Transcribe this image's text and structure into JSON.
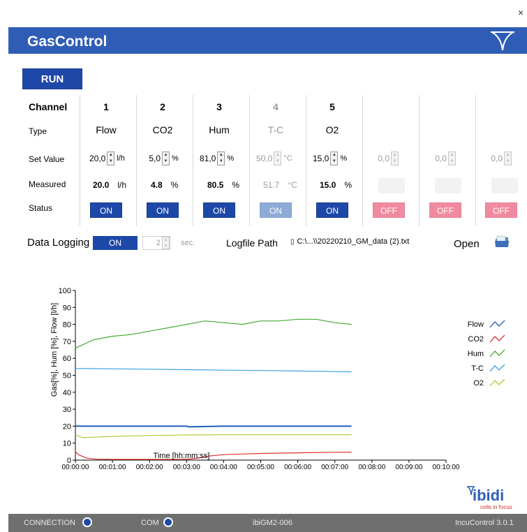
{
  "app": {
    "title": "GasControl",
    "close_glyph": "×"
  },
  "run_label": "RUN",
  "table": {
    "row_labels": {
      "channel": "Channel",
      "type": "Type",
      "set_value": "Set Value",
      "measured": "Measured",
      "status": "Status"
    },
    "channels": [
      {
        "num": "1",
        "type": "Flow",
        "set": "20,0",
        "unit": "l/h",
        "meas": "20.0",
        "meas_unit": "l/h",
        "status": "ON",
        "state": "on"
      },
      {
        "num": "2",
        "type": "CO2",
        "set": "5,0",
        "unit": "%",
        "meas": "4.8",
        "meas_unit": "%",
        "status": "ON",
        "state": "on"
      },
      {
        "num": "3",
        "type": "Hum",
        "set": "81,0",
        "unit": "%",
        "meas": "80.5",
        "meas_unit": "%",
        "status": "ON",
        "state": "on"
      },
      {
        "num": "4",
        "type": "T-C",
        "set": "50,0",
        "unit": "°C",
        "meas": "51.7",
        "meas_unit": "°C",
        "status": "ON",
        "state": "disabled"
      },
      {
        "num": "5",
        "type": "O2",
        "set": "15,0",
        "unit": "%",
        "meas": "15.0",
        "meas_unit": "%",
        "status": "ON",
        "state": "on"
      },
      {
        "num": "",
        "type": "",
        "set": "0,0",
        "unit": "",
        "meas": "",
        "meas_unit": "",
        "status": "OFF",
        "state": "off"
      },
      {
        "num": "",
        "type": "",
        "set": "0,0",
        "unit": "",
        "meas": "",
        "meas_unit": "",
        "status": "OFF",
        "state": "off"
      },
      {
        "num": "",
        "type": "",
        "set": "0,0",
        "unit": "",
        "meas": "",
        "meas_unit": "",
        "status": "OFF",
        "state": "off"
      }
    ]
  },
  "logging": {
    "label": "Data Logging",
    "toggle": "ON",
    "interval": "2",
    "interval_unit": "sec.",
    "path_label": "Logfile Path",
    "path_value": "C:\\...\\\\20220210_GM_data (2).txt",
    "open_label": "Open"
  },
  "colors": {
    "title_bar": "#2f5db6",
    "button_blue": "#1e48a8",
    "off_pink": "#f08aa0",
    "status_bar": "#6f6f6f"
  },
  "chart_data": {
    "type": "line",
    "title": "",
    "xlabel": "Time [hh:mm:ss]",
    "ylabel": "Gas[%], Hum [%], Flow [l/h]",
    "ylim": [
      0,
      100
    ],
    "yticks": [
      0,
      10,
      20,
      30,
      40,
      50,
      60,
      70,
      80,
      90,
      100
    ],
    "xticks": [
      "00:00:00",
      "00:01:00",
      "00:02:00",
      "00:03:00",
      "00:04:00",
      "00:05:00",
      "00:06:00",
      "00:07:00",
      "00:08:00",
      "00:09:00",
      "00:10:00"
    ],
    "xlim_minutes": [
      0,
      10
    ],
    "grid": false,
    "legend_position": "right",
    "series": [
      {
        "name": "Flow",
        "color": "#1f5fbf",
        "x": [
          0,
          1,
          2,
          3,
          3.05,
          4,
          5,
          6,
          7,
          7.45
        ],
        "y": [
          20,
          20,
          20,
          20,
          19.6,
          20,
          20,
          20,
          20,
          20
        ]
      },
      {
        "name": "CO2",
        "color": "#e03030",
        "x": [
          0,
          0.1,
          0.3,
          0.6,
          1,
          2,
          3,
          3.3,
          3.6,
          4,
          4.5,
          5,
          5.5,
          6,
          6.5,
          7,
          7.45
        ],
        "y": [
          5,
          3,
          1.2,
          0.5,
          0.4,
          0.4,
          0.4,
          1.2,
          2.4,
          3.2,
          3.6,
          3.9,
          4.1,
          4.3,
          4.5,
          4.6,
          4.7
        ]
      },
      {
        "name": "Hum",
        "color": "#44aa33",
        "x": [
          0,
          0.2,
          0.5,
          1,
          1.5,
          2,
          2.5,
          3,
          3.5,
          4,
          4.5,
          5,
          5.5,
          6,
          6.5,
          7,
          7.45
        ],
        "y": [
          66,
          68,
          71,
          73,
          74,
          76,
          78,
          80,
          82,
          81,
          80,
          82,
          82,
          83,
          83,
          81,
          80
        ]
      },
      {
        "name": "T-C",
        "color": "#3aa0e0",
        "x": [
          0,
          1,
          2,
          3,
          4,
          5,
          6,
          7,
          7.45
        ],
        "y": [
          54,
          53.8,
          53.6,
          53.3,
          53,
          52.8,
          52.5,
          52.2,
          52
        ]
      },
      {
        "name": "O2",
        "color": "#b8c832",
        "x": [
          0,
          0.2,
          0.5,
          1,
          2,
          3,
          4,
          5,
          6,
          7,
          7.45
        ],
        "y": [
          15,
          13.2,
          13.5,
          14,
          14.5,
          14.8,
          15,
          15,
          15,
          15,
          15
        ]
      }
    ]
  },
  "branding": {
    "name": "ibidi",
    "tagline": "cells in focus"
  },
  "status_bar": {
    "connection_label": "CONNECTION",
    "com_label": "COM",
    "device": "ibiGM2-006",
    "version": "IncuControl 3.0.1"
  }
}
